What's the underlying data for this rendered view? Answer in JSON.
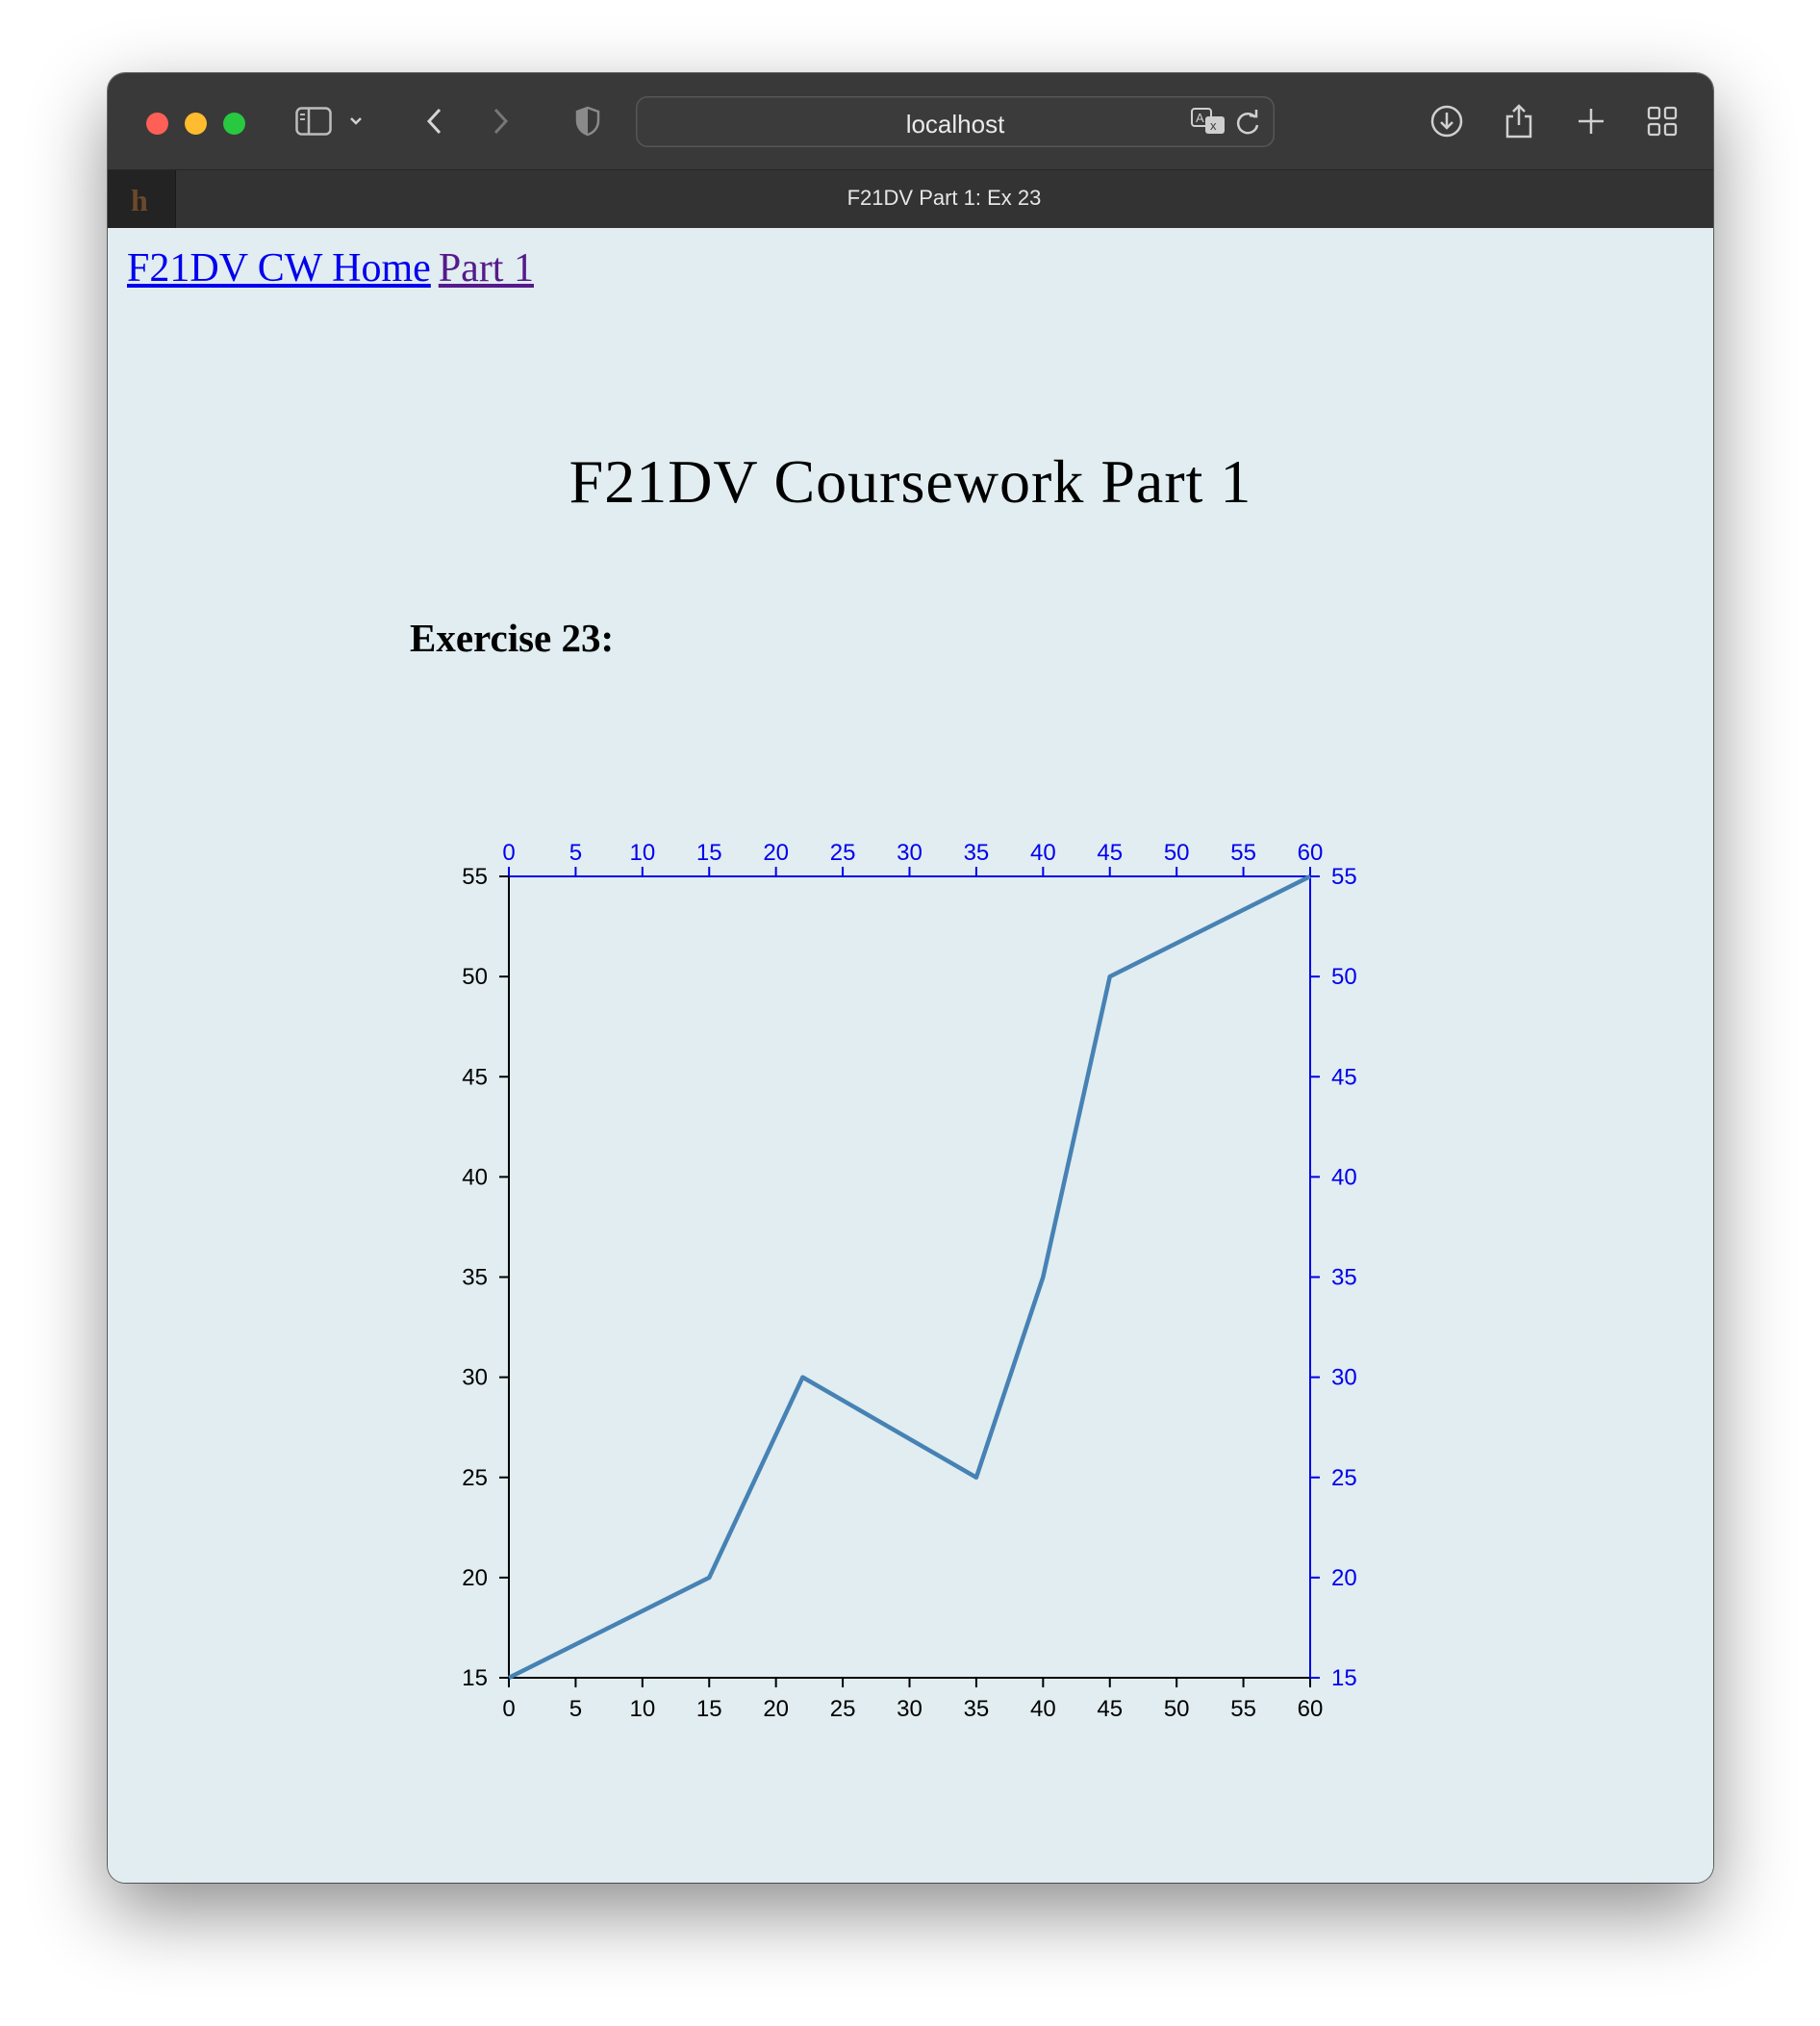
{
  "browser": {
    "address": "localhost",
    "tab_title": "F21DV Part 1: Ex 23",
    "favicon_letter": "h"
  },
  "nav": {
    "home_link": "F21DV CW Home",
    "part_link": "Part 1"
  },
  "page": {
    "title": "F21DV Coursework Part 1",
    "exercise_heading": "Exercise 23:"
  },
  "colors": {
    "line": "#4682b4",
    "secondary_axes": "#0000ee",
    "primary_axes": "#000000",
    "background": "#e1edf0"
  },
  "chart_data": {
    "type": "line",
    "x": [
      0,
      15,
      22,
      35,
      40,
      45,
      60
    ],
    "y": [
      15,
      20,
      30,
      25,
      35,
      50,
      55
    ],
    "xlim": [
      0,
      60
    ],
    "ylim": [
      15,
      55
    ],
    "x_ticks": [
      0,
      5,
      10,
      15,
      20,
      25,
      30,
      35,
      40,
      45,
      50,
      55,
      60
    ],
    "y_ticks": [
      15,
      20,
      25,
      30,
      35,
      40,
      45,
      50,
      55
    ],
    "axes": {
      "bottom": "black",
      "left": "black",
      "top": "blue",
      "right": "blue"
    },
    "grid": false,
    "legend": "none"
  }
}
